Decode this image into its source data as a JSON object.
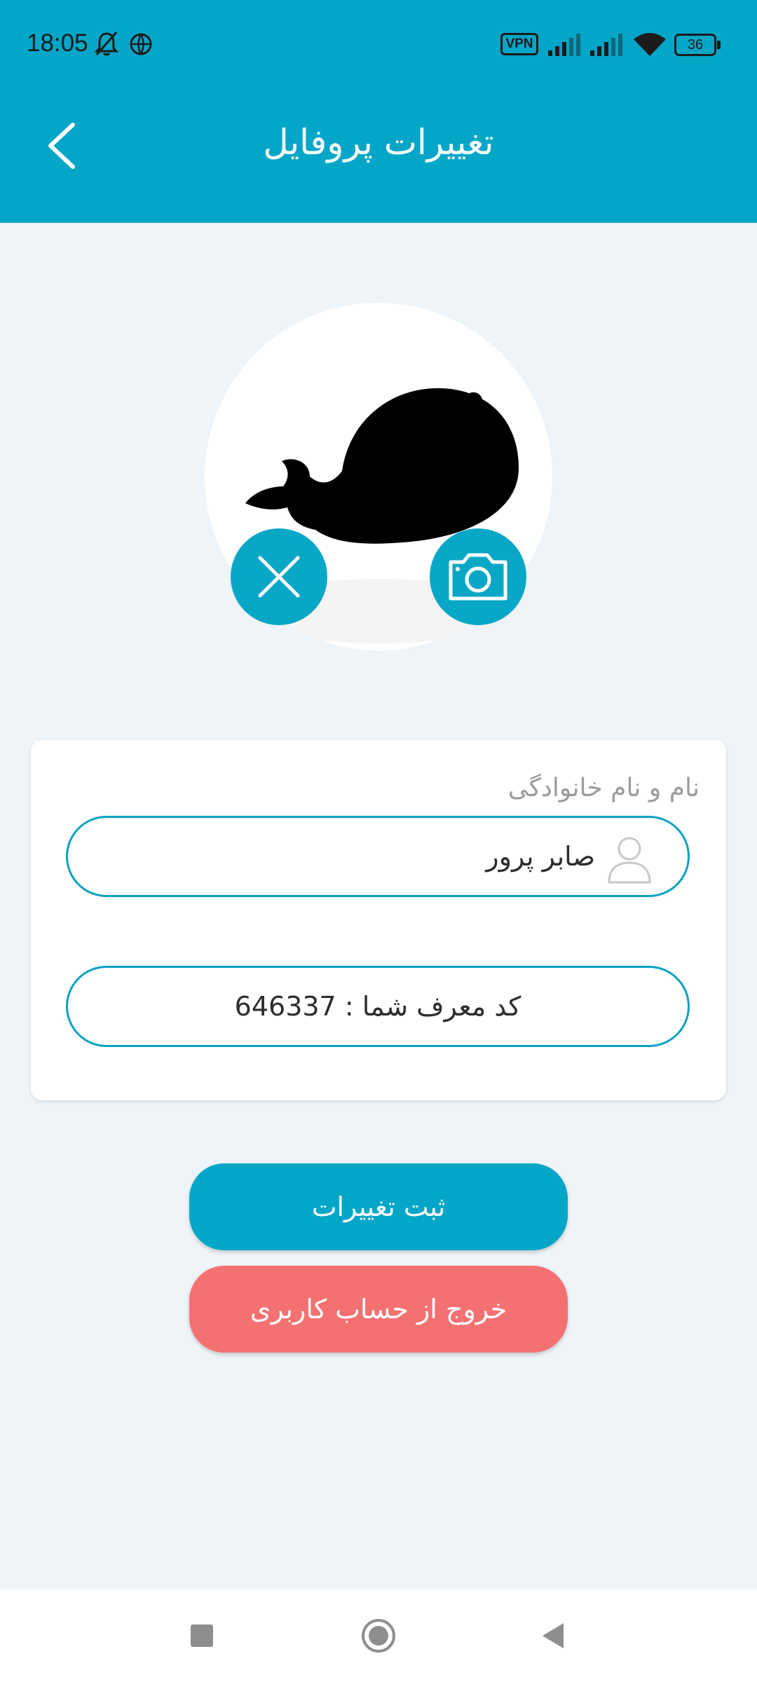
{
  "status_bar": {
    "time": "18:05",
    "vpn": "VPN",
    "battery": "36"
  },
  "header": {
    "title": "تغییرات پروفایل"
  },
  "icons": {
    "back": "chevron-left-icon",
    "remove_photo": "close-icon",
    "change_photo": "camera-icon",
    "user": "user-icon",
    "mute": "bell-off-icon",
    "network": "network-icon",
    "signal": "signal-icon",
    "wifi": "wifi-icon",
    "nav_recent": "square-icon",
    "nav_home": "circle-icon",
    "nav_back": "triangle-back-icon"
  },
  "form": {
    "name_label": "نام و نام خانوادگی",
    "name_value": "صابر پرور",
    "referral_text": "کد معرف شما : 646337"
  },
  "actions": {
    "save_label": "ثبت تغییرات",
    "logout_label": "خروج از حساب کاربری"
  },
  "colors": {
    "primary": "#03a6c7",
    "danger": "#f47172",
    "background": "#eef4f8",
    "status_text": "#1b1b1b"
  }
}
